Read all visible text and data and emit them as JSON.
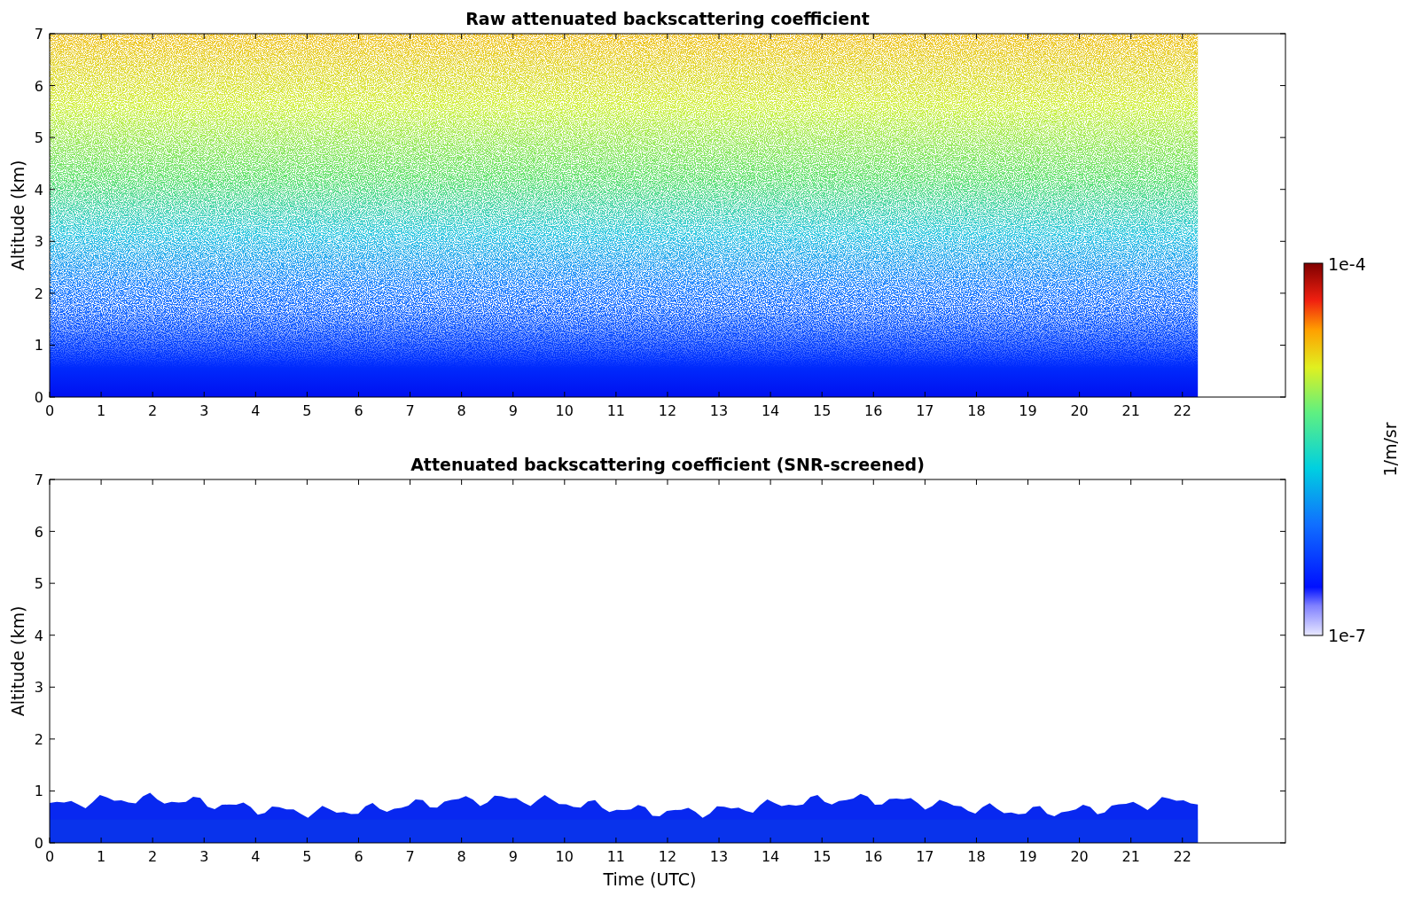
{
  "panels": [
    {
      "kind": "raw",
      "title": "Raw attenuated backscattering coefficient",
      "ylabel": "Altitude (km)",
      "yticks": [
        "7",
        "6",
        "5",
        "4",
        "3",
        "2",
        "1",
        "0"
      ],
      "xticks": [
        "0",
        "1",
        "2",
        "3",
        "4",
        "5",
        "6",
        "7",
        "8",
        "9",
        "10",
        "11",
        "12",
        "13",
        "14",
        "15",
        "16",
        "17",
        "18",
        "19",
        "20",
        "21",
        "22"
      ]
    },
    {
      "kind": "screened",
      "title": "Attenuated backscattering coefficient (SNR-screened)",
      "ylabel": "Altitude (km)",
      "xlabel": "Time (UTC)",
      "yticks": [
        "7",
        "6",
        "5",
        "4",
        "3",
        "2",
        "1",
        "0"
      ],
      "xticks": [
        "0",
        "1",
        "2",
        "3",
        "4",
        "5",
        "6",
        "7",
        "8",
        "9",
        "10",
        "11",
        "12",
        "13",
        "14",
        "15",
        "16",
        "17",
        "18",
        "19",
        "20",
        "21",
        "22"
      ]
    }
  ],
  "colorbar": {
    "max_label": "1e-4",
    "min_label": "1e-7",
    "unit": "1/m/sr"
  }
}
